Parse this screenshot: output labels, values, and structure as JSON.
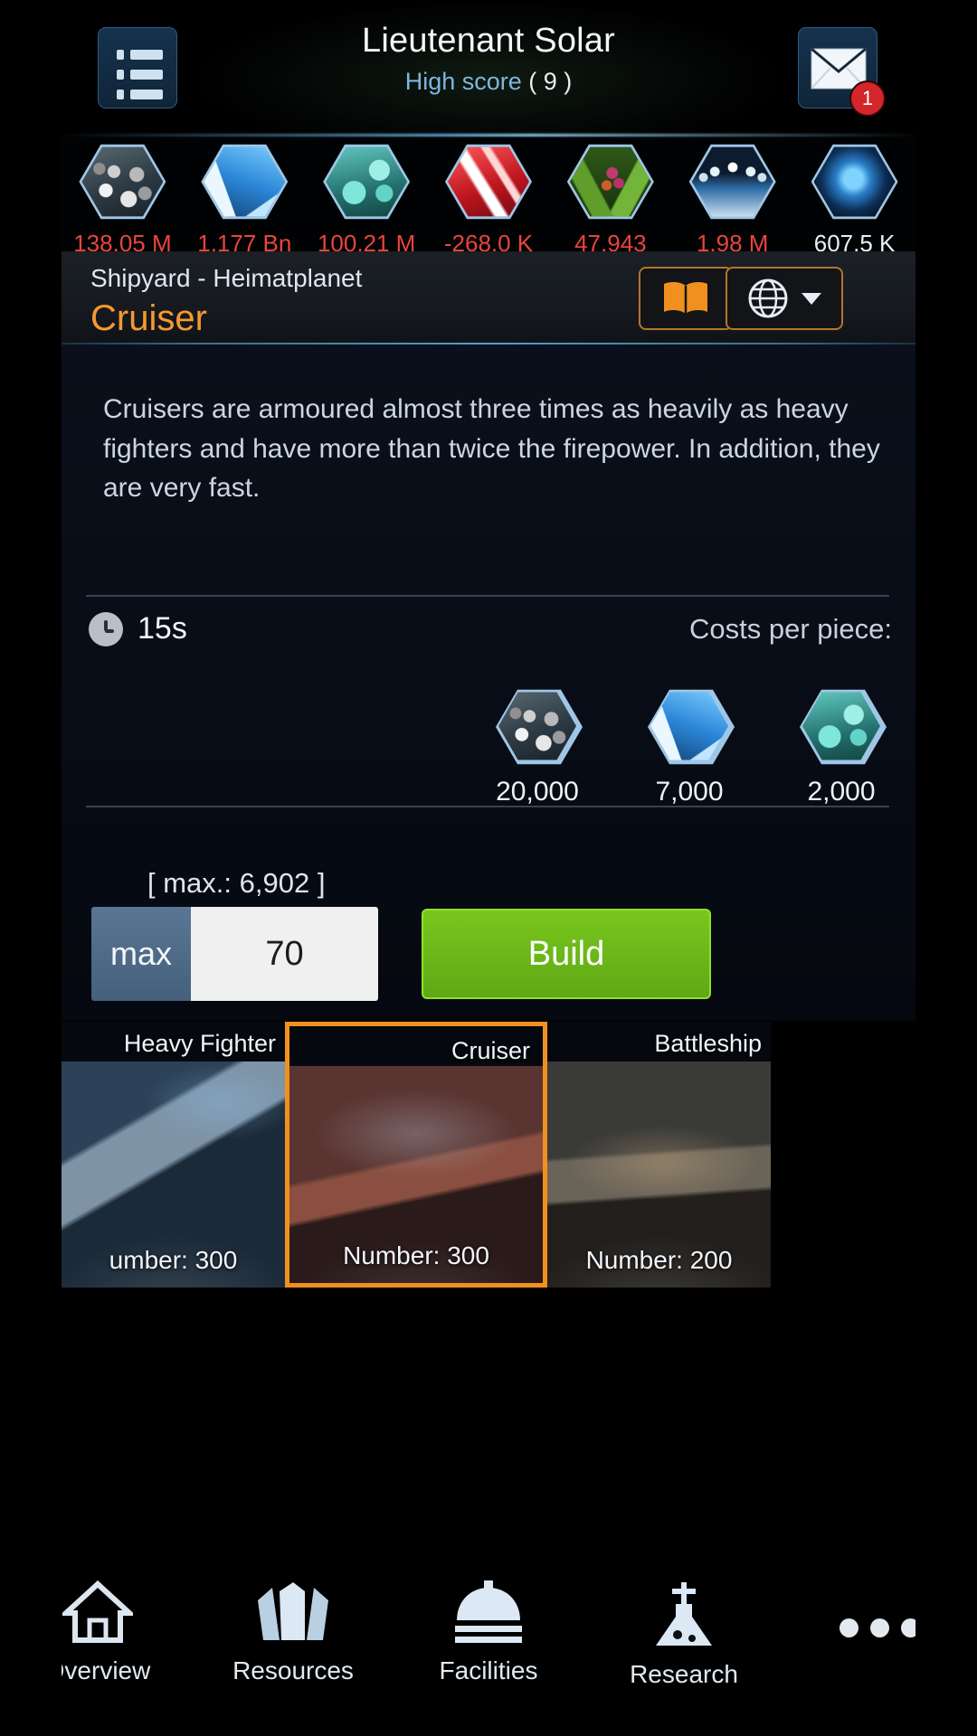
{
  "topbar": {
    "menu_icon": "list-menu-icon",
    "player_name": "Lieutenant Solar",
    "high_score_label": "High score",
    "high_score_value": "( 9 )",
    "mail_icon": "envelope-icon",
    "mail_badge": "1"
  },
  "resources": [
    {
      "icon": "metal-icon",
      "value": "138.05 M",
      "color": "#e8453c"
    },
    {
      "icon": "crystal-icon",
      "value": "1.177 Bn",
      "color": "#e8453c"
    },
    {
      "icon": "deuterium-icon",
      "value": "100.21 M",
      "color": "#e8453c"
    },
    {
      "icon": "energy-icon",
      "value": "-268.0 K",
      "color": "#e8453c"
    },
    {
      "icon": "food-icon",
      "value": "47,943",
      "color": "#e8453c"
    },
    {
      "icon": "population-icon",
      "value": "1.98 M",
      "color": "#e8453c"
    },
    {
      "icon": "dark-matter-icon",
      "value": "607.5 K",
      "color": "#e9f0f6"
    }
  ],
  "shipyard_header": {
    "breadcrumb": "Shipyard - Heimatplanet",
    "ship_name": "Cruiser",
    "book_icon": "open-book-icon",
    "globe_icon": "globe-icon",
    "dropdown_icon": "caret-down-icon",
    "accent_color": "#f59a2e"
  },
  "detail": {
    "description": "Cruisers are armoured almost three times as heavily as heavy fighters and have more than twice the firepower. In addition, they are very fast.",
    "clock_icon": "clock-icon",
    "build_time": "15s",
    "costs_label": "Costs per piece:",
    "costs": [
      {
        "icon": "metal-icon",
        "value": "20,000"
      },
      {
        "icon": "crystal-icon",
        "value": "7,000"
      },
      {
        "icon": "deuterium-icon",
        "value": "2,000"
      }
    ],
    "max_label": "[ max.: 6,902 ]",
    "max_button": "max",
    "quantity_value": "70",
    "quantity_placeholder": "0",
    "build_button": "Build",
    "build_color": "#79c71d"
  },
  "carousel": [
    {
      "name": "Heavy Fighter",
      "count_label": "umber: 300",
      "selected": false
    },
    {
      "name": "Cruiser",
      "count_label": "Number: 300",
      "selected": true
    },
    {
      "name": "Battleship",
      "count_label": "Number: 200",
      "selected": false
    }
  ],
  "nav": [
    {
      "icon": "home-icon",
      "label": "Overview"
    },
    {
      "icon": "crystal-icon",
      "label": "Resources"
    },
    {
      "icon": "factory-icon",
      "label": "Facilities"
    },
    {
      "icon": "flask-icon",
      "label": "Research"
    },
    {
      "icon": "more-dots-icon",
      "label": ""
    }
  ]
}
